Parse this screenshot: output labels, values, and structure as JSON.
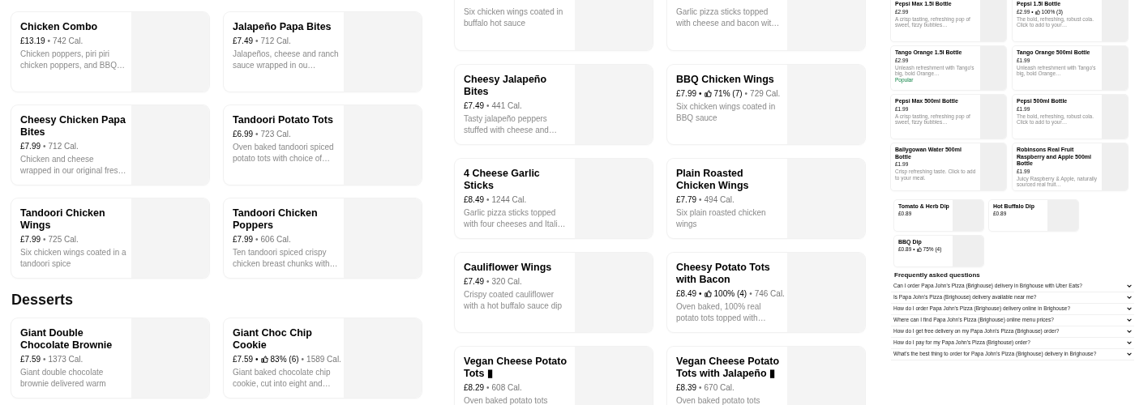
{
  "separator": "•",
  "panels": [
    {
      "sections": [
        {
          "items": [
            {
              "title": "Chicken Combo",
              "price": "£13.19",
              "calories": "742 Cal.",
              "description": "Chicken poppers, piri piri chicken poppers, and BBQ…"
            },
            {
              "title": "Jalapeño Papa Bites",
              "price": "£7.49",
              "calories": "712 Cal.",
              "description": "Jalapeños, cheese and ranch sauce wrapped in ou…"
            },
            {
              "title": "Cheesy Chicken Papa Bites",
              "price": "£7.99",
              "calories": "712 Cal.",
              "description": "Chicken and cheese wrapped in our original fres…"
            },
            {
              "title": "Tandoori Potato Tots",
              "price": "£6.99",
              "calories": "723 Cal.",
              "description": "Oven baked tandoori spiced potato tots with choice of…"
            },
            {
              "title": "Tandoori Chicken Wings",
              "price": "£7.99",
              "calories": "725 Cal.",
              "description": "Six chicken wings coated in a tandoori spice"
            },
            {
              "title": "Tandoori Chicken Poppers",
              "price": "£7.99",
              "calories": "606 Cal.",
              "description": "Ten tandoori spiced crispy chicken breast chunks with…"
            }
          ]
        },
        {
          "heading": "Desserts",
          "items": [
            {
              "title": "Giant Double Chocolate Brownie",
              "price": "£7.59",
              "calories": "1373 Cal.",
              "description": "Giant double chocolate brownie delivered warm"
            },
            {
              "title": "Giant Choc Chip Cookie",
              "price": "£7.59",
              "rating": "83% (6)",
              "calories": "1589 Cal.",
              "description": "Giant baked chocolate chip cookie, cut into eight and…"
            }
          ]
        }
      ]
    },
    {
      "sections": [
        {
          "items": [
            {
              "description": "Six chicken wings coated in buffalo hot sauce"
            },
            {
              "description": "Garlic pizza sticks topped with cheese and bacon wit…"
            },
            {
              "title": "Cheesy Jalapeño Bites",
              "price": "£7.49",
              "calories": "441 Cal.",
              "description": "Tasty jalapeño peppers stuffed with cheese and…"
            },
            {
              "title": "BBQ Chicken Wings",
              "price": "£7.99",
              "rating": "71% (7)",
              "calories": "729 Cal.",
              "description": "Six chicken wings coated in BBQ sauce"
            },
            {
              "title": "4 Cheese Garlic Sticks",
              "price": "£8.49",
              "calories": "1244 Cal.",
              "description": "Garlic pizza sticks topped with four cheeses and Itali…"
            },
            {
              "title": "Plain Roasted Chicken Wings",
              "price": "£7.79",
              "calories": "494 Cal.",
              "description": "Six plain roasted chicken wings"
            },
            {
              "title": "Cauliflower Wings",
              "price": "£7.49",
              "calories": "320 Cal.",
              "description": "Crispy coated cauliflower with a hot buffalo sauce dip"
            },
            {
              "title": "Cheesy Potato Tots with Bacon",
              "price": "£8.49",
              "rating": "100% (4)",
              "calories": "746 Cal.",
              "description": "Oven baked, 100% real potato tots topped with…"
            },
            {
              "title": "Vegan Cheese Potato Tots ▮",
              "price": "£8.29",
              "calories": "608 Cal.",
              "description": "Oven baked potato tots"
            },
            {
              "title": "Vegan Cheese Potato Tots with Jalapeño ▮",
              "price": "£8.39",
              "calories": "670 Cal.",
              "description": "Oven baked potato tots"
            }
          ]
        }
      ]
    },
    {
      "sections": [
        {
          "items": [
            {
              "title": "Pepsi Max 1.5l Bottle",
              "price": "£2.99",
              "description": "A crisp tasting, refreshing pop of sweet, fizzy bubbles…"
            },
            {
              "title": "Pepsi 1.5l Bottle",
              "price": "£2.99",
              "rating": "100% (3)",
              "description": "The bold, refreshing, robust cola. Click to add to your…"
            },
            {
              "title": "Tango Orange 1.5l Bottle",
              "price": "£2.99",
              "description": "Unleash refreshment with Tango's big, bold Orange…",
              "tag": "Popular"
            },
            {
              "title": "Tango Orange 500ml Bottle",
              "price": "£1.99",
              "description": "Unleash refreshment with Tango's big, bold Orange…"
            },
            {
              "title": "Pepsi Max 500ml Bottle",
              "price": "£1.99",
              "description": "A crisp tasting, refreshing pop of sweet, fizzy bubbles…"
            },
            {
              "title": "Pepsi 500ml Bottle",
              "price": "£1.99",
              "description": "The bold, refreshing, robust cola. Click to add to your…"
            },
            {
              "title": "Ballygowan Water 500ml Bottle",
              "price": "£1.99",
              "description": "Crisp refreshing taste. Click to add to your meal."
            },
            {
              "title": "Robinsons Real Fruit Raspberry and Apple 500ml Bottle",
              "price": "£1.99",
              "description": "Juicy Raspberry & Apple, naturally sourced real fruit…"
            }
          ]
        },
        {
          "kind": "dips",
          "items": [
            {
              "title": "Tomato & Herb Dip",
              "price": "£0.89"
            },
            {
              "title": "Hot Buffalo Dip",
              "price": "£0.89"
            },
            {
              "title": "BBQ Dip",
              "price": "£0.89",
              "rating": "75% (4)"
            }
          ]
        }
      ],
      "faq": {
        "title": "Frequently asked questions",
        "questions": [
          "Can I order Papa John's Pizza (Brighouse) delivery in Brighouse with Uber Eats?",
          "Is Papa John's Pizza (Brighouse) delivery available near me?",
          "How do I order Papa John's Pizza (Brighouse) delivery online in Brighouse?",
          "Where can I find Papa John's Pizza (Brighouse) online menu prices?",
          "How do I get free delivery on my Papa John's Pizza (Brighouse) order?",
          "How do I pay for my Papa John's Pizza (Brighouse) order?",
          "What's the best thing to order for Papa John's Pizza (Brighouse) delivery in Brighouse?"
        ]
      }
    }
  ]
}
